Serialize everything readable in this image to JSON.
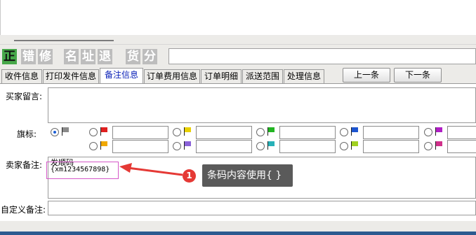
{
  "mode_buttons": [
    "正",
    "错",
    "修",
    "名",
    "址",
    "退",
    "货",
    "分"
  ],
  "tabs": [
    "收件信息",
    "打印发件信息",
    "备注信息",
    "订单费用信息",
    "订单明细",
    "派送范围",
    "处理信息"
  ],
  "active_tab": "备注信息",
  "nav": {
    "prev_label": "上一条",
    "next_label": "下一条"
  },
  "remarks": {
    "buyer_message_label": "买家留言:",
    "flag_label": "旗标:",
    "seller_remark_label": "卖家备注:",
    "seller_remark_line1": "发顺码",
    "seller_remark_line2": "{xm1234567898}",
    "custom_remark_label": "自定义备注:"
  },
  "flags": [
    {
      "color": "#8a8a8a",
      "name": "gray-flag-icon",
      "selected": true
    },
    {
      "color": "#e02020",
      "name": "red-flag-icon"
    },
    {
      "color": "#e8d000",
      "name": "yellow-flag-icon"
    },
    {
      "color": "#22b522",
      "name": "green-flag-icon"
    },
    {
      "color": "#1d55d0",
      "name": "blue-flag-icon"
    },
    {
      "color": "#b01fc5",
      "name": "purple-flag-icon"
    },
    {
      "color": "#f0a800",
      "name": "orange-flag-icon"
    },
    {
      "color": "#8a62d8",
      "name": "violet-flag-icon"
    },
    {
      "color": "#27b1b8",
      "name": "teal-flag-icon"
    },
    {
      "color": "#a0d020",
      "name": "lime-flag-icon"
    },
    {
      "color": "#d0308a",
      "name": "pink-flag-icon"
    }
  ],
  "annotation": {
    "number": "1",
    "text": "条码内容使用{ }"
  },
  "colors": {
    "accent_green": "#47a84a",
    "active_tab_text": "#0b22b8",
    "highlight_border": "#d557c8",
    "annotation_red": "#e53935"
  }
}
